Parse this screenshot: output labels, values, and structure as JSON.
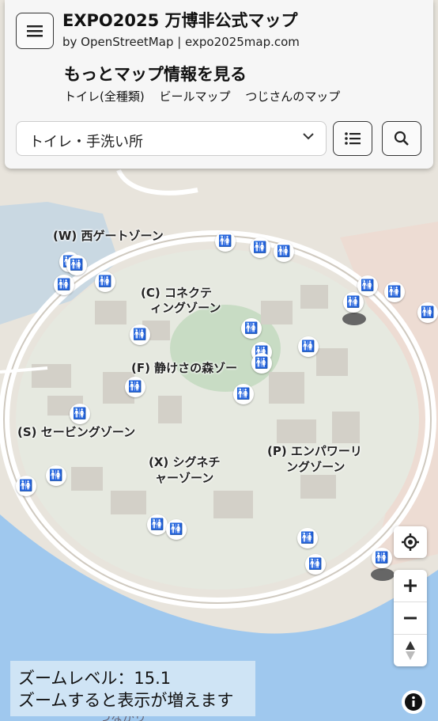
{
  "header": {
    "title": "EXPO2025 万博非公式マップ",
    "subtitle": "by OpenStreetMap | expo2025map.com",
    "more_heading": "もっとマップ情報を見る",
    "links": [
      "トイレ(全種類)",
      "ビールマップ",
      "つじさんのマップ"
    ]
  },
  "filter": {
    "selected": "トイレ・手洗い所"
  },
  "icons": {
    "menu": "hamburger-icon",
    "list": "list-icon",
    "search": "search-icon",
    "locate": "locate-icon",
    "zoom_in": "plus-icon",
    "zoom_out": "minus-icon",
    "compass": "compass-icon",
    "info": "info-icon",
    "toilet": "toilet-icon"
  },
  "map": {
    "zones": [
      {
        "id": "w",
        "text": "(W) 西ゲートゾーン"
      },
      {
        "id": "c1",
        "text": "(C) コネクテ"
      },
      {
        "id": "c2",
        "text": "ィングゾーン"
      },
      {
        "id": "f",
        "text": "(F) 静けさの森ゾー"
      },
      {
        "id": "s",
        "text": "(S) セービングゾーン"
      },
      {
        "id": "x1",
        "text": "(X) シグネチ"
      },
      {
        "id": "x2",
        "text": "ャーゾーン"
      },
      {
        "id": "p1",
        "text": "(P) エンパワーリ"
      },
      {
        "id": "p2",
        "text": "ングゾーン"
      }
    ],
    "bottom_text": "つながり"
  },
  "zoom": {
    "line1": "ズームレベル：15.1",
    "line2": "ズームすると表示が増えます"
  },
  "colors": {
    "water": "#9fc8ee",
    "land": "#e8e4dc",
    "ring": "#f3f1ec",
    "zoom_box": "#cfe4f5"
  }
}
